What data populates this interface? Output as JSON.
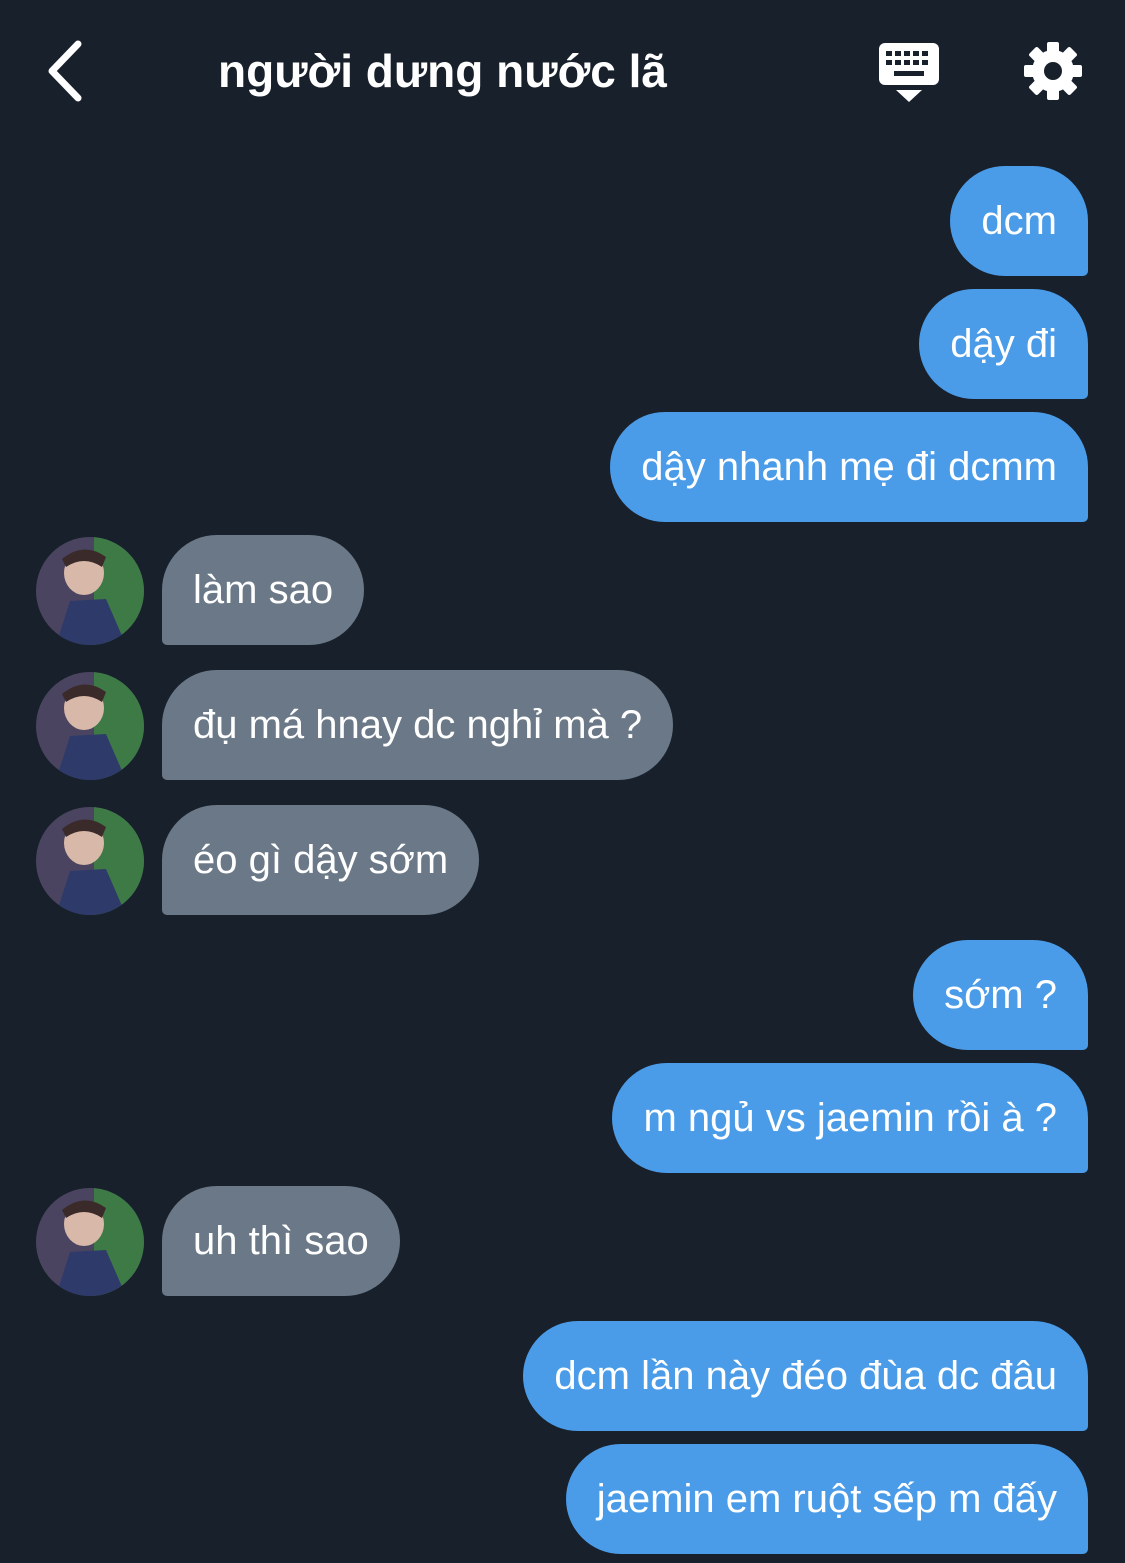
{
  "header": {
    "title": "người dưng nước lã",
    "back_icon": "chevron-left-icon",
    "keyboard_icon": "keyboard-hide-icon",
    "settings_icon": "gear-icon"
  },
  "colors": {
    "background": "#18202b",
    "sent_bubble": "#4a9be8",
    "received_bubble": "#6a7887",
    "text": "#ffffff"
  },
  "messages": [
    {
      "from": "me",
      "text": "dcm"
    },
    {
      "from": "me",
      "text": "dậy đi"
    },
    {
      "from": "me",
      "text": "dậy nhanh mẹ đi dcmm"
    },
    {
      "from": "them",
      "text": "làm sao"
    },
    {
      "from": "them",
      "text": "đụ má hnay dc nghỉ mà ?"
    },
    {
      "from": "them",
      "text": "éo gì dậy sớm"
    },
    {
      "from": "me",
      "text": "sớm ?"
    },
    {
      "from": "me",
      "text": "m ngủ vs jaemin rồi à ?"
    },
    {
      "from": "them",
      "text": "uh thì sao"
    },
    {
      "from": "me",
      "text": "dcm lần này đéo đùa dc đâu"
    },
    {
      "from": "me",
      "text": "jaemin em ruột sếp m đấy"
    }
  ]
}
